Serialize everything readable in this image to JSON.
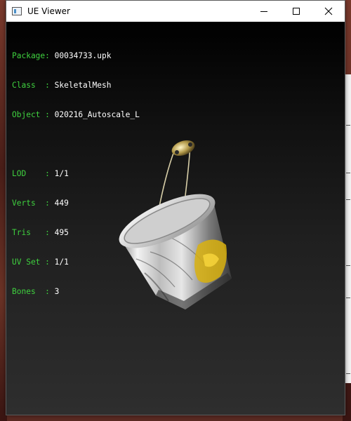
{
  "window": {
    "title": "UE Viewer",
    "controls": {
      "minimize_icon": "minimize-icon",
      "maximize_icon": "maximize-icon",
      "close_icon": "close-icon"
    }
  },
  "info": {
    "package": {
      "label": "Package:",
      "value": "00034733.upk"
    },
    "class": {
      "label": "Class  :",
      "value": "SkeletalMesh"
    },
    "object": {
      "label": "Object :",
      "value": "020216_Autoscale_L"
    },
    "lod": {
      "label": "LOD    :",
      "value": "1/1"
    },
    "verts": {
      "label": "Verts  :",
      "value": "449"
    },
    "tris": {
      "label": "Tris   :",
      "value": "495"
    },
    "uvset": {
      "label": "UV Set :",
      "value": "1/1"
    },
    "bones": {
      "label": "Bones  :",
      "value": "3"
    }
  },
  "colors": {
    "label_green": "#3fd13f",
    "value_white": "#ffffff",
    "viewport_top": "#000000",
    "viewport_bottom": "#2e2e2e"
  },
  "model": {
    "name": "bucket-mesh-preview",
    "icon": "bucket-icon"
  }
}
